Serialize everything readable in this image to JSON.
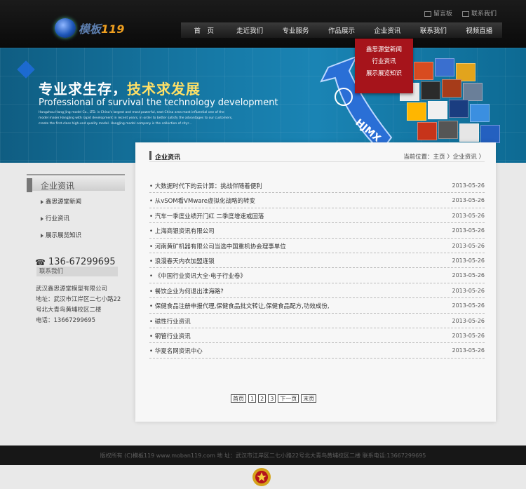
{
  "header": {
    "logo_text_prefix": "模板",
    "logo_text_suffix": "119",
    "toplinks": [
      {
        "label": "留言板",
        "icon": "mail-icon"
      },
      {
        "label": "联系我们",
        "icon": "phone-icon"
      }
    ],
    "nav": [
      "首　页",
      "走近我们",
      "专业服务",
      "作品展示",
      "企业资讯",
      "联系我们",
      "视频直播"
    ]
  },
  "dropdown": [
    "鑫思源堂新闻",
    "行业资讯",
    "展示展览知识"
  ],
  "banner": {
    "cn_white": "专业求生存，",
    "cn_yellow": "技术求发展",
    "en_title": "Professional of survival the technology development",
    "en_body": "Hangzhou Hang Jing model Co., LTD. is China's largest and most powerful, east China area most influential one of the model maker.HangJing with rapid development in recent years, in order to better satisfy the advantages to our customers, create the first-class high-end quality model. HangJing model company is the collection of cityr...",
    "arrow_text": "HJMX"
  },
  "sidebar": {
    "title": "企业资讯",
    "items": [
      "鑫思源堂新闻",
      "行业资讯",
      "展示展览知识"
    ],
    "phone": "136-67299695",
    "contact_title": "联系我们",
    "contact_lines": [
      "武汉鑫思源堂模型有限公司",
      "地址：武汉市江岸区二七小路22号北大青鸟黄埔校区二楼",
      "电话：13667299695"
    ]
  },
  "main": {
    "title": "企业资讯",
    "breadcrumb": "当前位置：主页 〉企业资讯 〉",
    "news": [
      {
        "title": "大数据时代下的云计算：挑战伴随着便利",
        "date": "2013-05-26"
      },
      {
        "title": "从vSOM看VMware虚拟化战略的转变",
        "date": "2013-05-26"
      },
      {
        "title": "汽车一季度业绩开门红 二季度增速或回落",
        "date": "2013-05-26"
      },
      {
        "title": "上海商银资讯有限公司",
        "date": "2013-05-26"
      },
      {
        "title": "河南黄矿机器有限公司当选中国重机协会理事单位",
        "date": "2013-05-26"
      },
      {
        "title": "浪漫春天内衣加盟连锁",
        "date": "2013-05-26"
      },
      {
        "title": "《中国行业资讯大全·电子行业卷》",
        "date": "2013-05-26"
      },
      {
        "title": "餐饮企业为何退出淮海路?",
        "date": "2013-05-26"
      },
      {
        "title": "保健食品注册申报代理,保健食品批文转让,保健食品配方,功效成份,",
        "date": "2013-05-26"
      },
      {
        "title": "磁性行业资讯",
        "date": "2013-05-26"
      },
      {
        "title": "钢管行业资讯",
        "date": "2013-05-26"
      },
      {
        "title": "华夏名网资讯中心",
        "date": "2013-05-26"
      }
    ],
    "pager": [
      "首页",
      "1",
      "2",
      "3",
      "下一页",
      "末页"
    ]
  },
  "footer": {
    "text": "版权所有 (C)模板119 www.moban119.com 地 址：武汉市江岸区二七小路22号北大青鸟黄埔校区二楼 联系电话:13667299695"
  },
  "colors": {
    "banner_blue": "#1679a6",
    "dropdown_red": "#a6141b",
    "logo_orange": "#f0a020"
  }
}
